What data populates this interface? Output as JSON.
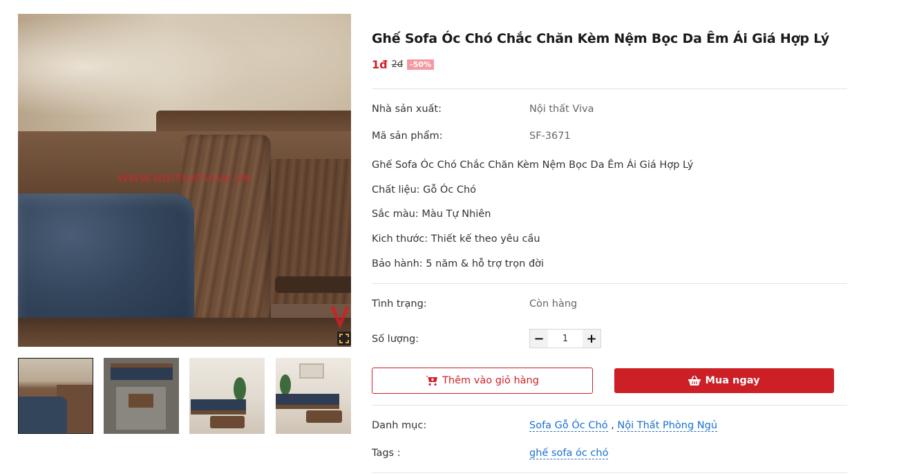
{
  "product": {
    "title": "Ghế Sofa Óc Chó Chắc Chăn Kèm Nệm Bọc Da Êm Ái Giá Hợp Lý",
    "price": "1đ",
    "old_price": "2đ",
    "discount": "-50%",
    "watermark": "WWW.NOITHATVIVA.VN"
  },
  "specs": {
    "manufacturer_label": "Nhà sản xuất:",
    "manufacturer_value": "Nội thất Viva",
    "sku_label": "Mã sản phẩm:",
    "sku_value": "SF-3671"
  },
  "description": [
    "Ghế Sofa Óc Chó Chắc Chăn Kèm Nệm Bọc Da Êm Ái Giá Hợp Lý",
    "Chất liệu: Gỗ Óc Chó",
    "Sắc màu: Màu Tự Nhiên",
    "Kich thước: Thiết kế theo yêu cầu",
    "Bảo hành: 5 năm & hỗ trợ trọn đời"
  ],
  "stock": {
    "label": "Tình trạng:",
    "value": "Còn hàng"
  },
  "quantity": {
    "label": "Số lượng:",
    "value": "1",
    "minus": "−",
    "plus": "+"
  },
  "actions": {
    "add_to_cart": "Thêm vào giỏ hàng",
    "buy_now": "Mua ngay"
  },
  "meta": {
    "category_label": "Danh mục:",
    "categories": [
      "Sofa Gỗ Óc Chó",
      "Nội Thất Phòng Ngủ"
    ],
    "category_separator": ",",
    "tags_label": "Tags :",
    "tags": [
      "ghế sofa óc chó"
    ]
  },
  "colors": {
    "accent": "#cc1f26",
    "link": "#1a6fd1",
    "discount_bg": "#f39aa0"
  }
}
